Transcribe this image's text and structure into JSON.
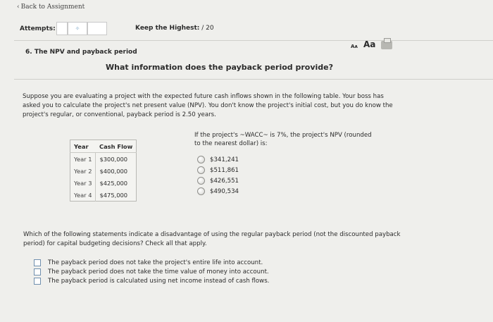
{
  "nav": {
    "back_label": "Back to Assignment"
  },
  "header": {
    "attempts_label": "Attempts:",
    "attempts_icon": "✧",
    "keep_label": "Keep the Highest:",
    "keep_value": "/ 20"
  },
  "question": {
    "title": "6. The NPV and payback period",
    "font_small": "Aᴀ",
    "font_large": "Aa",
    "heading": "What information does the payback period provide?",
    "paragraph": "Suppose you are evaluating a project with the expected future cash inflows shown in the following table. Your boss has asked you to calculate the project's net present value (NPV). You don't know the project's initial cost, but you do know the project's regular, or conventional, payback period is 2.50 years."
  },
  "table": {
    "headers": [
      "Year",
      "Cash Flow"
    ],
    "rows": [
      [
        "Year 1",
        "$300,000"
      ],
      [
        "Year 2",
        "$400,000"
      ],
      [
        "Year 3",
        "$425,000"
      ],
      [
        "Year 4",
        "$475,000"
      ]
    ]
  },
  "npv": {
    "question": "If the project's ~WACC~ is 7%, the project's NPV (rounded to the nearest dollar) is:",
    "options": [
      "$341,241",
      "$511,861",
      "$426,551",
      "$490,534"
    ]
  },
  "disadvantage": {
    "question": "Which of the following statements indicate a disadvantage of using the regular payback period (not the discounted payback period) for capital budgeting decisions? Check all that apply.",
    "options": [
      "The payback period does not take the project's entire life into account.",
      "The payback period does not take the time value of money into account.",
      "The payback period is calculated using net income instead of cash flows."
    ]
  }
}
